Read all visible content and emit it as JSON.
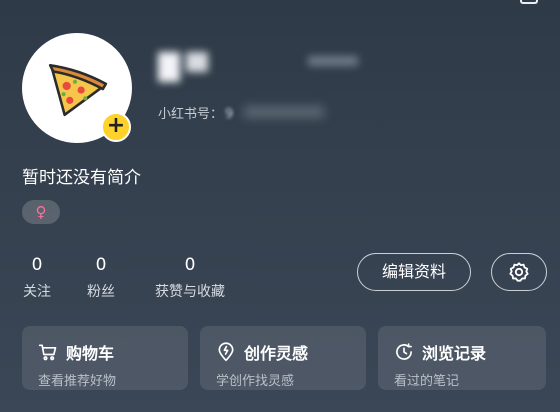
{
  "profile": {
    "redbook_id_label": "小红书号：",
    "redbook_id_value": "9",
    "bio": "暂时还没有简介",
    "gender_symbol": "♀"
  },
  "stats": [
    {
      "count": "0",
      "label": "关注"
    },
    {
      "count": "0",
      "label": "粉丝"
    },
    {
      "count": "0",
      "label": "获赞与收藏"
    }
  ],
  "actions": {
    "edit_label": "编辑资料"
  },
  "cards": [
    {
      "title": "购物车",
      "subtitle": "查看推荐好物",
      "icon": "cart-icon"
    },
    {
      "title": "创作灵感",
      "subtitle": "学创作找灵感",
      "icon": "lightbulb-pin-icon"
    },
    {
      "title": "浏览记录",
      "subtitle": "看过的笔记",
      "icon": "clock-icon"
    }
  ],
  "colors": {
    "add_button": "#ffd12b",
    "gender": "#ff6f9c"
  }
}
